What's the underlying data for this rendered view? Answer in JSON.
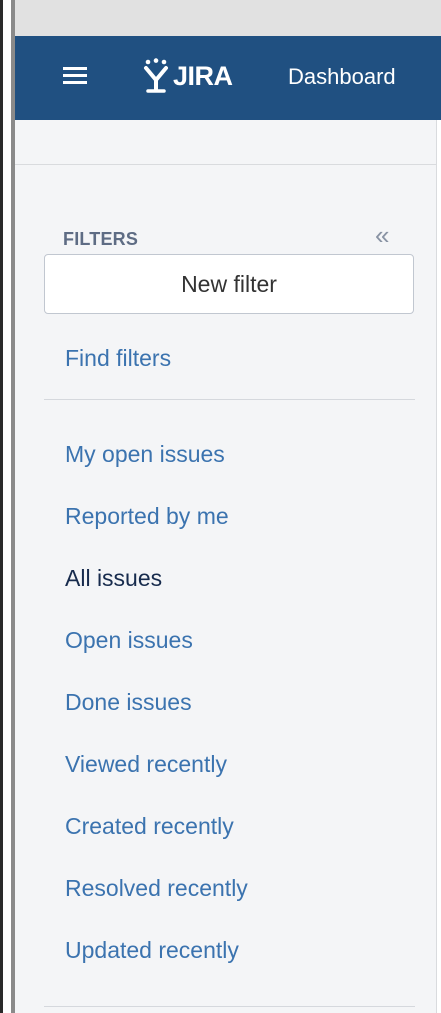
{
  "app": {
    "logo_text": "JIRA",
    "accent_color": "#205081",
    "link_color": "#3b73af"
  },
  "header": {
    "menu_icon": "hamburger-icon",
    "nav_item": "Dashboard"
  },
  "sidebar": {
    "heading": "FILTERS",
    "collapse_icon": "double-chevron-left-icon",
    "collapse_glyph": "«",
    "new_filter_label": "New filter",
    "find_filters_label": "Find filters",
    "items": [
      {
        "label": "My open issues"
      },
      {
        "label": "Reported by me"
      },
      {
        "label": "All issues",
        "active": true
      },
      {
        "label": "Open issues"
      },
      {
        "label": "Done issues"
      },
      {
        "label": "Viewed recently"
      },
      {
        "label": "Created recently"
      },
      {
        "label": "Resolved recently"
      },
      {
        "label": "Updated recently"
      }
    ]
  }
}
